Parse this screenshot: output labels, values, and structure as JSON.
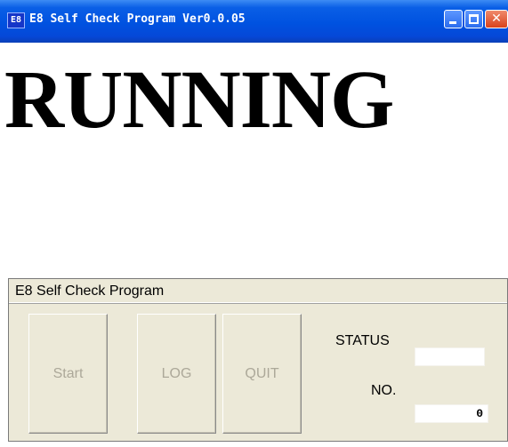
{
  "window": {
    "title": "E8 Self Check Program Ver0.0.05",
    "icon_label": "E8",
    "controls": [
      "minimize",
      "maximize",
      "close"
    ]
  },
  "main": {
    "state_text": "RUNNING"
  },
  "panel": {
    "title": "E8 Self Check Program",
    "buttons": {
      "start": "Start",
      "log": "LOG",
      "quit": "QUIT"
    },
    "status_label": "STATUS",
    "status_value": "",
    "no_label": "NO.",
    "no_value": "0"
  },
  "colors": {
    "titlebar": "#0052e0",
    "panel_background": "#ece9d8",
    "disabled_text": "#aca899"
  }
}
